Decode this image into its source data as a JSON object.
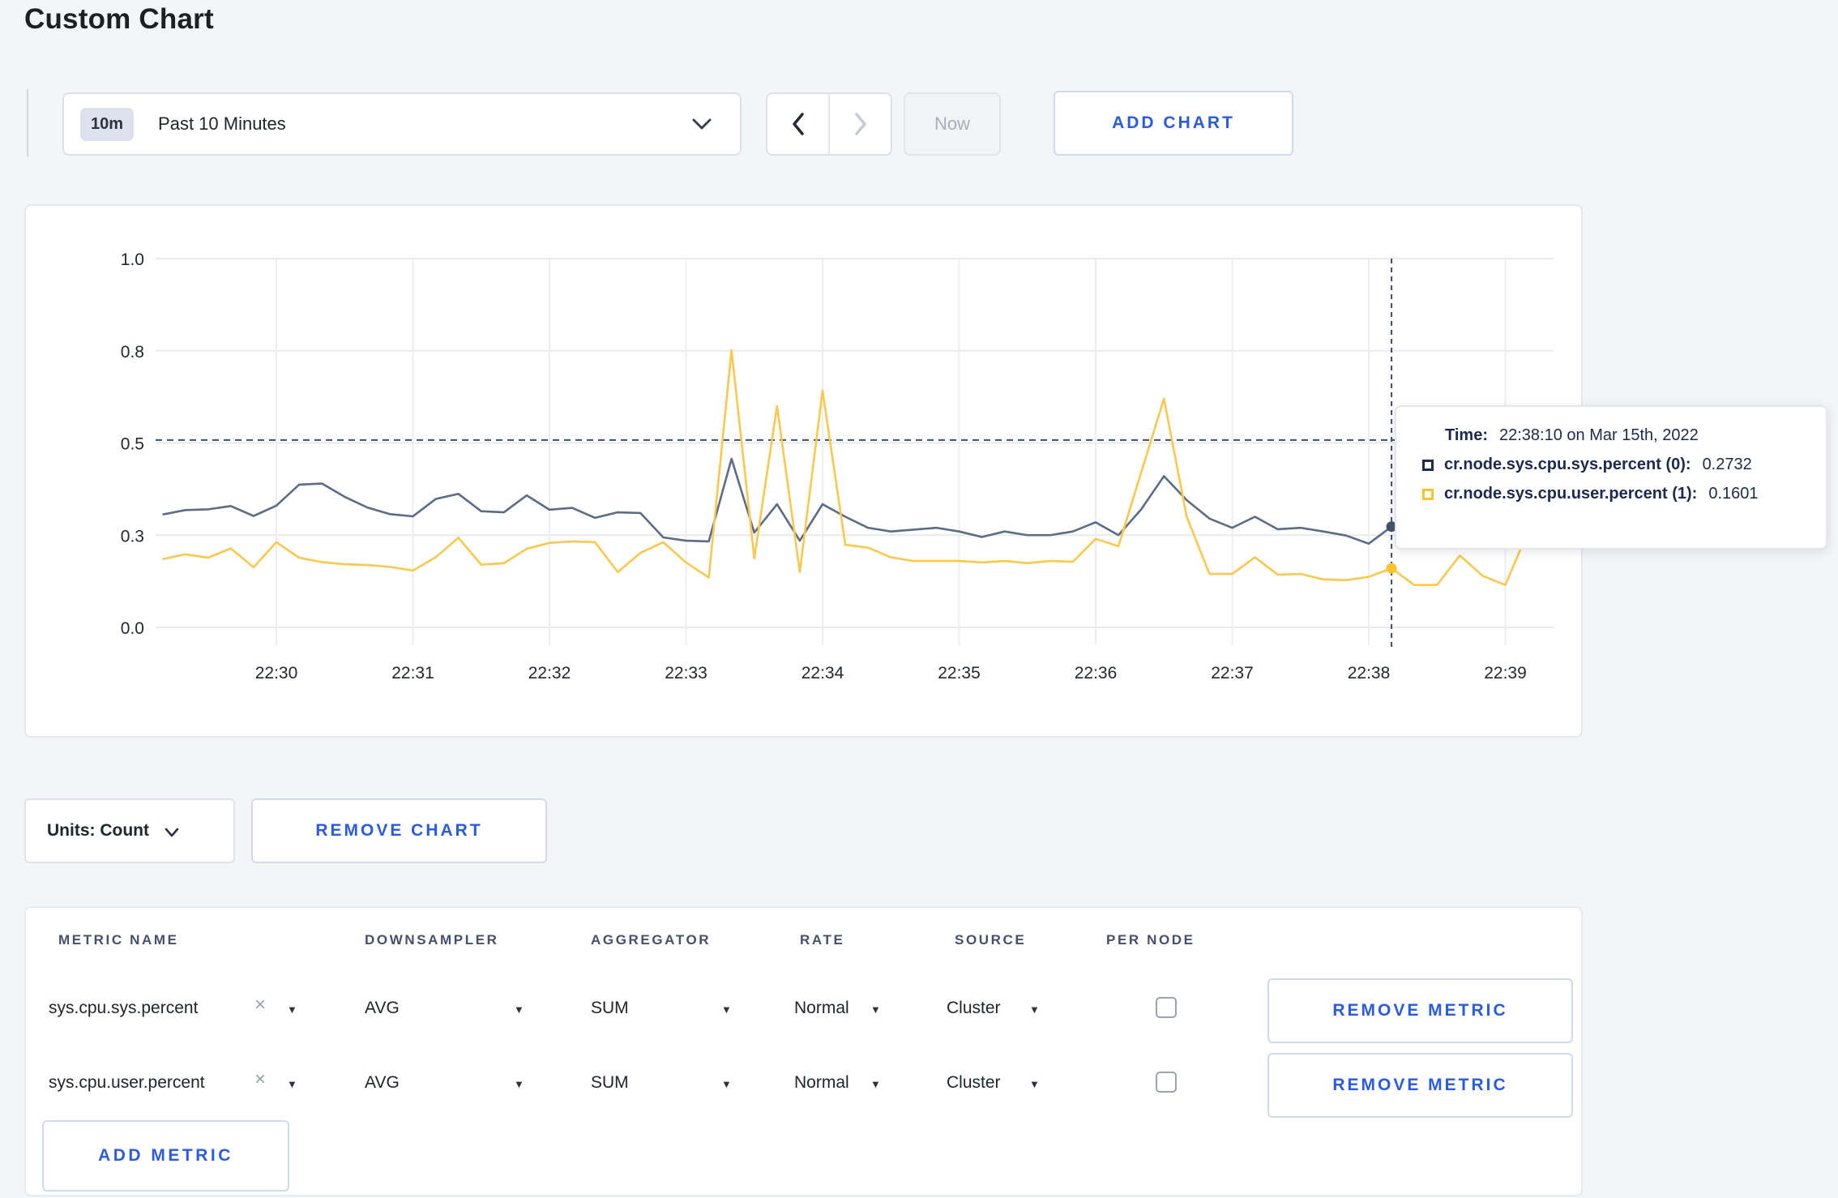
{
  "page": {
    "title": "Custom Chart"
  },
  "toolbar": {
    "time_range": {
      "badge": "10m",
      "label": "Past 10 Minutes"
    },
    "now_label": "Now",
    "add_chart_label": "ADD CHART"
  },
  "chart_data": {
    "type": "line",
    "title": "",
    "xlabel": "",
    "ylabel": "",
    "ylim": [
      0,
      1
    ],
    "grid": true,
    "legend": "tooltip-only",
    "x_tick_labels": [
      "22:30",
      "22:31",
      "22:32",
      "22:33",
      "22:34",
      "22:35",
      "22:36",
      "22:37",
      "22:38",
      "22:39"
    ],
    "y_tick_labels": [
      "0.0",
      "0.3",
      "0.5",
      "0.8",
      "1.0"
    ],
    "y_tick_values": [
      0,
      0.25,
      0.5,
      0.75,
      1.0
    ],
    "sample_start": "22:29:10",
    "sample_interval_seconds": 10,
    "hover": {
      "index": 54,
      "time": "22:38:10",
      "guide_value": 0.508
    },
    "series": [
      {
        "name": "cr.node.sys.cpu.sys.percent",
        "color": "#5C6C87",
        "values": [
          0.306,
          0.318,
          0.32,
          0.329,
          0.302,
          0.33,
          0.387,
          0.39,
          0.354,
          0.325,
          0.307,
          0.301,
          0.348,
          0.362,
          0.315,
          0.312,
          0.358,
          0.319,
          0.324,
          0.297,
          0.312,
          0.31,
          0.244,
          0.235,
          0.233,
          0.457,
          0.257,
          0.334,
          0.235,
          0.334,
          0.3,
          0.27,
          0.26,
          0.265,
          0.27,
          0.26,
          0.245,
          0.26,
          0.25,
          0.25,
          0.26,
          0.285,
          0.25,
          0.32,
          0.41,
          0.345,
          0.295,
          0.27,
          0.3,
          0.266,
          0.27,
          0.26,
          0.249,
          0.227,
          0.2732,
          0.3,
          0.31,
          0.3,
          0.295,
          0.3,
          0.3
        ]
      },
      {
        "name": "cr.node.sys.cpu.user.percent",
        "color": "#FBC84F",
        "values": [
          0.185,
          0.198,
          0.189,
          0.214,
          0.163,
          0.231,
          0.189,
          0.177,
          0.171,
          0.169,
          0.164,
          0.154,
          0.19,
          0.243,
          0.17,
          0.174,
          0.213,
          0.229,
          0.233,
          0.231,
          0.15,
          0.202,
          0.231,
          0.176,
          0.135,
          0.752,
          0.187,
          0.6,
          0.15,
          0.642,
          0.224,
          0.216,
          0.19,
          0.18,
          0.18,
          0.18,
          0.176,
          0.18,
          0.174,
          0.18,
          0.178,
          0.24,
          0.22,
          0.42,
          0.62,
          0.3,
          0.145,
          0.145,
          0.19,
          0.143,
          0.145,
          0.13,
          0.128,
          0.137,
          0.1601,
          0.115,
          0.115,
          0.195,
          0.14,
          0.115,
          0.26
        ]
      }
    ]
  },
  "tooltip": {
    "time_label": "Time:",
    "time_value": "22:38:10 on Mar 15th, 2022",
    "rows": [
      {
        "label": "cr.node.sys.cpu.sys.percent (0):",
        "value": "0.2732",
        "swatch_color": "#1B2A4E"
      },
      {
        "label": "cr.node.sys.cpu.user.percent (1):",
        "value": "0.1601",
        "swatch_color": "#FCC32B"
      }
    ]
  },
  "chart_footer": {
    "units_label": "Units: Count",
    "remove_chart_label": "REMOVE CHART"
  },
  "metrics_table": {
    "headers": [
      "METRIC NAME",
      "DOWNSAMPLER",
      "AGGREGATOR",
      "RATE",
      "SOURCE",
      "PER NODE"
    ],
    "rows": [
      {
        "metric": "sys.cpu.sys.percent",
        "downsampler": "AVG",
        "aggregator": "SUM",
        "rate": "Normal",
        "source": "Cluster",
        "per_node_checked": false,
        "remove_label": "REMOVE METRIC"
      },
      {
        "metric": "sys.cpu.user.percent",
        "downsampler": "AVG",
        "aggregator": "SUM",
        "rate": "Normal",
        "source": "Cluster",
        "per_node_checked": false,
        "remove_label": "REMOVE METRIC"
      }
    ],
    "add_metric_label": "ADD METRIC"
  },
  "colors": {
    "page_bg": "#f4f5f7",
    "accent_blue": "#2b5be0",
    "series_sys_line": "#5C6C87",
    "series_user_line": "#FBC84F",
    "swatch_sys": "#1B2A4E",
    "swatch_user": "#FCC32B",
    "gridline": "#e9eaec",
    "crosshair": "#3C4C6B"
  }
}
